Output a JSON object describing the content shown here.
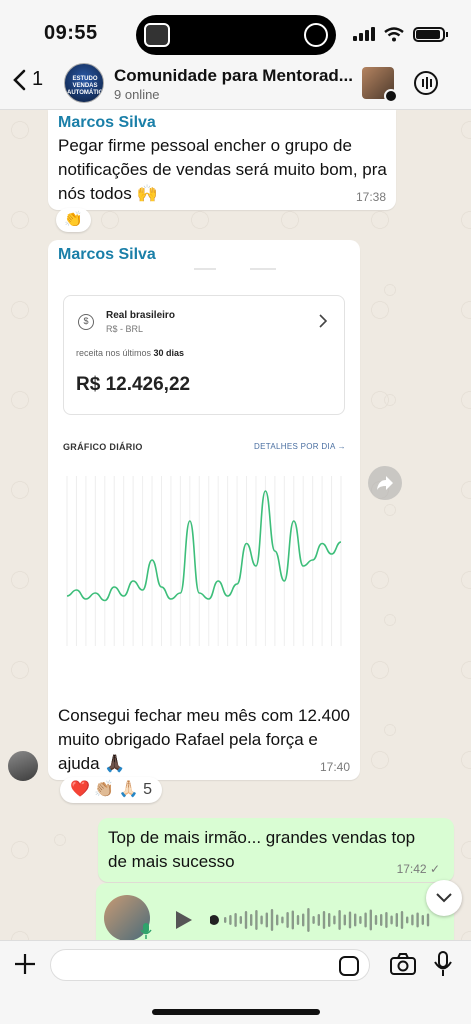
{
  "status": {
    "time": "09:55"
  },
  "header": {
    "back_count": "1",
    "avatar_text": "ESTUDO VENDAS AUTOMÁTICAS",
    "title": "Comunidade para Mentorad...",
    "subtitle": "9 online"
  },
  "messages": [
    {
      "sender": "Marcos Silva",
      "text": "Pegar firme pessoal encher o grupo de notificações de vendas será muito bom, pra nós todos 🙌",
      "time": "17:38",
      "reaction": "👏"
    },
    {
      "sender": "Marcos Silva",
      "image": {
        "currency_name": "Real brasileiro",
        "currency_code": "R$ - BRL",
        "period_prefix": "receita nos últimos ",
        "period_bold": "30 dias",
        "amount": "R$ 12.426,22",
        "chart_title": "GRÁFICO DIÁRIO",
        "chart_link": "DETALHES POR DIA →",
        "daily_values": [
          20,
          24,
          18,
          22,
          17,
          26,
          20,
          30,
          24,
          44,
          26,
          18,
          22,
          70,
          22,
          18,
          30,
          20,
          28,
          55,
          40,
          90,
          50,
          30,
          70,
          40,
          44,
          55,
          48,
          56
        ]
      },
      "text": "Consegui fechar meu mês com 12.400 muito obrigado Rafael pela força e ajuda 🙏🏿",
      "time": "17:40",
      "reactions": "❤️ 👏🏼 🙏🏻 5"
    },
    {
      "outgoing": true,
      "text": "Top de mais irmão... grandes vendas top de mais sucesso",
      "time": "17:42 ✓"
    }
  ],
  "colors": {
    "outgoing_bubble": "#d9fdd3",
    "sender_name": "#1a7fa8",
    "chart_line": "#3dbe7a"
  }
}
